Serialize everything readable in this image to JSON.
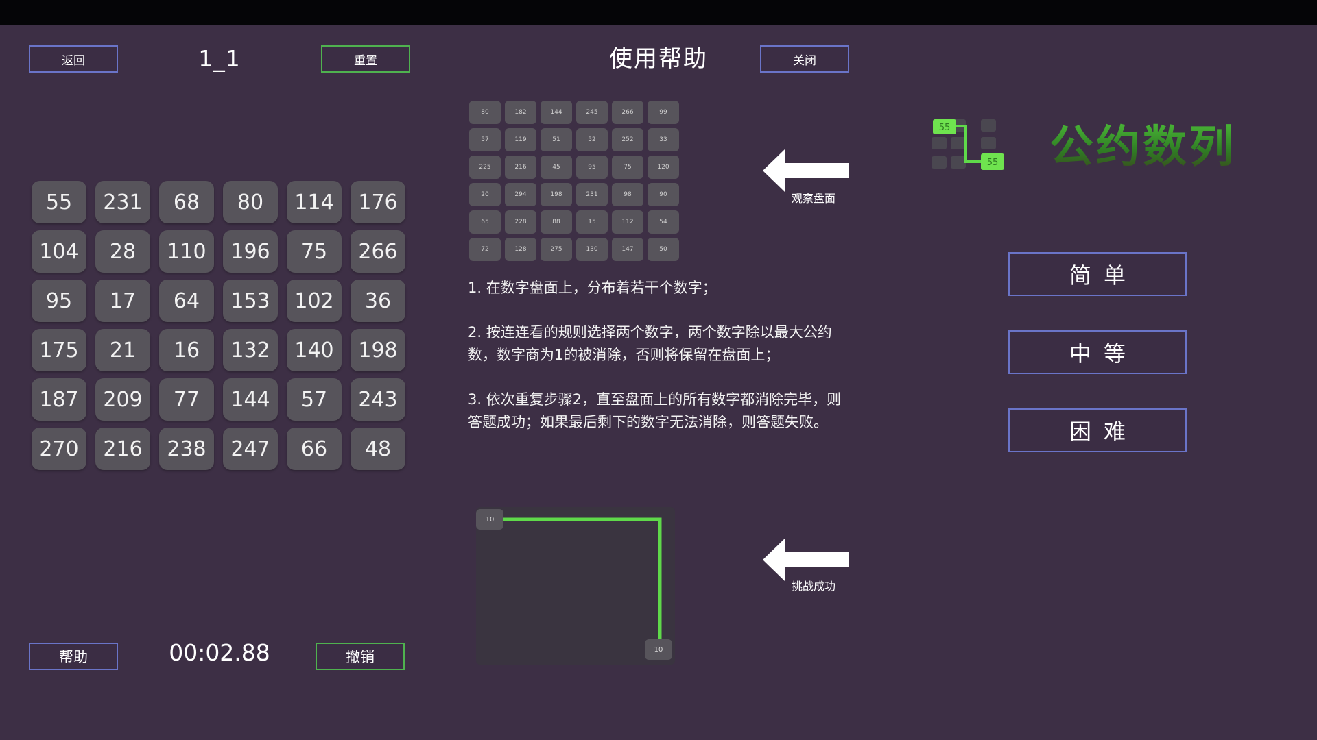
{
  "header": {
    "back_label": "返回",
    "level": "1_1",
    "reset_label": "重置",
    "help_title": "使用帮助",
    "close_label": "关闭"
  },
  "footer": {
    "help_label": "帮助",
    "timer": "00:02.88",
    "undo_label": "撤销"
  },
  "board": {
    "rows": [
      [
        "55",
        "231",
        "68",
        "80",
        "114",
        "176"
      ],
      [
        "104",
        "28",
        "110",
        "196",
        "75",
        "266"
      ],
      [
        "95",
        "17",
        "64",
        "153",
        "102",
        "36"
      ],
      [
        "175",
        "21",
        "16",
        "132",
        "140",
        "198"
      ],
      [
        "187",
        "209",
        "77",
        "144",
        "57",
        "243"
      ],
      [
        "270",
        "216",
        "238",
        "247",
        "66",
        "48"
      ]
    ]
  },
  "help": {
    "mini_board": [
      [
        "80",
        "182",
        "144",
        "245",
        "266",
        "99"
      ],
      [
        "57",
        "119",
        "51",
        "52",
        "252",
        "33"
      ],
      [
        "225",
        "216",
        "45",
        "95",
        "75",
        "120"
      ],
      [
        "20",
        "294",
        "198",
        "231",
        "98",
        "90"
      ],
      [
        "65",
        "228",
        "88",
        "15",
        "112",
        "54"
      ],
      [
        "72",
        "128",
        "275",
        "130",
        "147",
        "50"
      ]
    ],
    "observe_label": "观察盘面",
    "rules": [
      "1. 在数字盘面上，分布着若干个数字；",
      "2. 按连连看的规则选择两个数字，两个数字除以最大公约数，数字商为1的被消除，否则将保留在盘面上；",
      "3. 依次重复步骤2，直至盘面上的所有数字都消除完毕，则答题成功；如果最后剩下的数字无法消除，则答题失败。"
    ],
    "demo_start": "10",
    "demo_end": "10",
    "success_label": "挑战成功"
  },
  "menu": {
    "title": "公约数列",
    "logo_numbers": [
      "55",
      "55"
    ],
    "easy_label": "简单",
    "medium_label": "中等",
    "hard_label": "困难"
  },
  "colors": {
    "background": "#3d2f45",
    "cell": "#57545b",
    "accent_green": "#4fb24f",
    "accent_blue": "#6a74c8"
  }
}
